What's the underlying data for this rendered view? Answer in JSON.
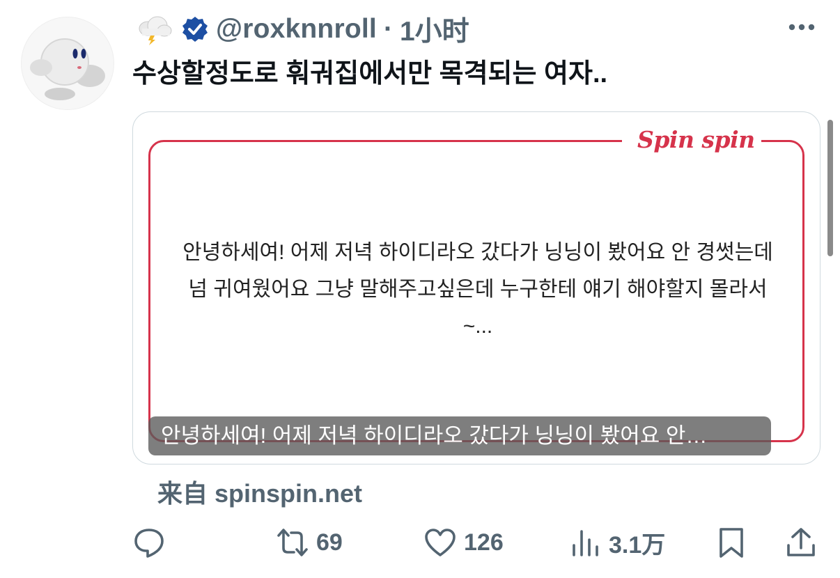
{
  "tweet": {
    "handle": "@roxknnroll",
    "separator": "·",
    "time": "1小时",
    "text": "수상할정도로 훠궈집에서만 목격되는 여자.."
  },
  "card": {
    "brand": "Spin spin",
    "body": "안녕하세여! 어제 저녁 하이디라오 갔다가 닝닝이 봤어요 안 경썻는데 넘 귀여웠어요 그냥 말해주고싶은데 누구한테 얘기 해야할지 몰라서 ~...",
    "caption": "안녕하세여! 어제 저녁 하이디라오 갔다가 닝닝이 봤어요 안…",
    "accent": "#d6334b"
  },
  "source": "来自 spinspin.net",
  "actions": {
    "reply": {
      "icon": "reply-icon",
      "count": ""
    },
    "retweet": {
      "icon": "retweet-icon",
      "count": "69"
    },
    "like": {
      "icon": "heart-icon",
      "count": "126"
    },
    "views": {
      "icon": "views-icon",
      "count": "3.1万"
    },
    "bookmark": {
      "icon": "bookmark-icon"
    },
    "share": {
      "icon": "share-icon"
    }
  },
  "colors": {
    "text_secondary": "#536471",
    "verified": "#1d4fa3"
  }
}
